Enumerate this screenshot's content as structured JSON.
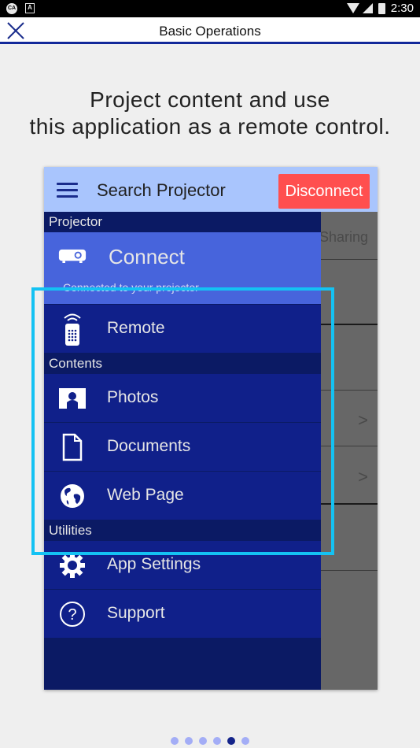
{
  "status_bar": {
    "left_icons": [
      "ca-notification-icon",
      "a-notification-icon"
    ],
    "right_icons": [
      "wifi-icon",
      "signal-icon",
      "battery-charging-icon"
    ],
    "time": "2:30",
    "ca_label": "CA",
    "a_label": "A"
  },
  "app_bar": {
    "close_icon": "close-icon",
    "title": "Basic Operations"
  },
  "headline": {
    "line1": "Project content and use",
    "line2": "this application as a remote control."
  },
  "phone": {
    "toolbar": {
      "menu_icon": "hamburger-icon",
      "title": "Search Projector",
      "disconnect_label": "Disconnect"
    },
    "background_screen": {
      "tab_label": "Sharing",
      "chevrons": [
        ">",
        ">"
      ]
    },
    "drawer": {
      "sections": [
        {
          "header": "Projector",
          "items": [
            {
              "label": "Connect",
              "icon": "projector-icon",
              "subtitle": "Connected to your projector",
              "selected": true
            },
            {
              "label": "Remote",
              "icon": "remote-control-icon"
            }
          ]
        },
        {
          "header": "Contents",
          "items": [
            {
              "label": "Photos",
              "icon": "photo-icon"
            },
            {
              "label": "Documents",
              "icon": "document-icon"
            },
            {
              "label": "Web Page",
              "icon": "globe-icon"
            }
          ]
        },
        {
          "header": "Utilities",
          "items": [
            {
              "label": "App Settings",
              "icon": "gear-icon"
            },
            {
              "label": "Support",
              "icon": "help-icon"
            }
          ]
        }
      ]
    },
    "highlight_color": "#14c2f3"
  },
  "pager": {
    "total": 6,
    "active_index": 4
  },
  "colors": {
    "drawer_bg": "#10208a",
    "section_bg": "#0b1a64",
    "selected_bg": "#4764dc",
    "toolbar_bg": "#a9c5fd",
    "disconnect_bg": "#ff4f4f",
    "app_bar_accent": "#12289a"
  }
}
